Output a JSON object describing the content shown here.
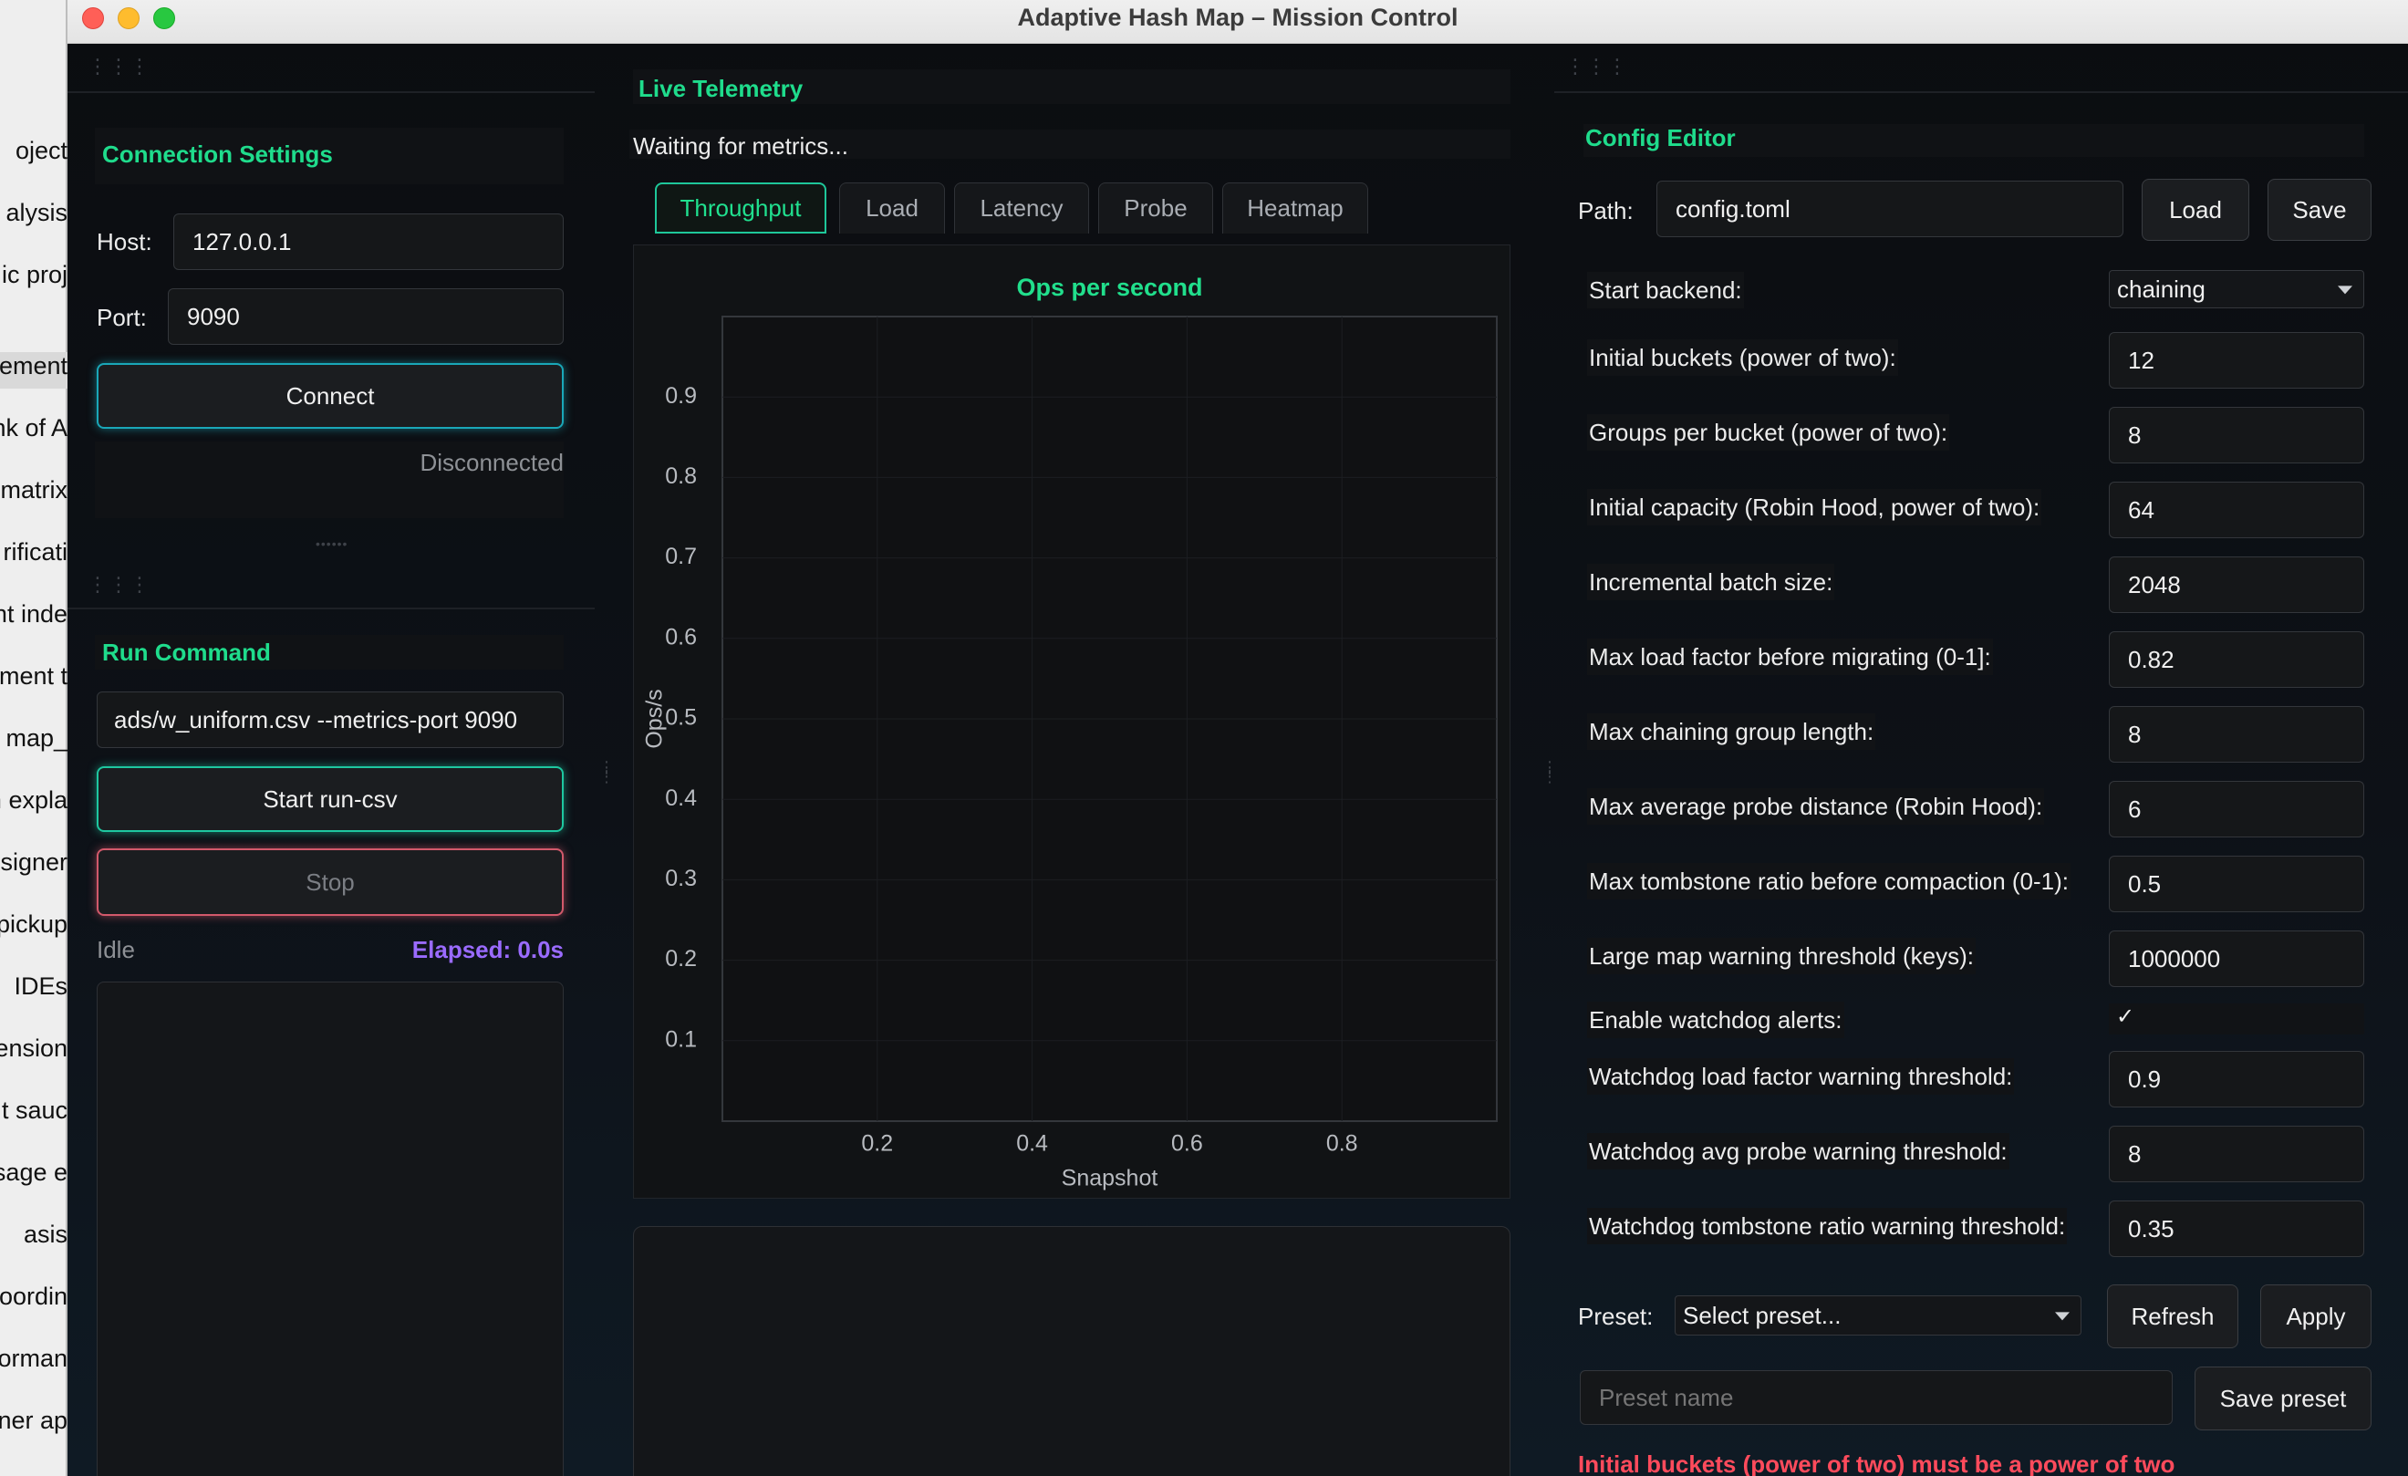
{
  "background_window": {
    "items": [
      "oject",
      "alysis",
      "ic proj",
      "ement",
      "nk of A",
      "matrix",
      "rificati",
      "nt inde",
      "ment t",
      "map_",
      "n expla",
      "esigner",
      "pickup",
      "IDEs",
      "ension",
      "t sauc",
      "sage e",
      "asis",
      "oordin",
      "forman",
      "ner ap"
    ]
  },
  "window": {
    "title": "Adaptive Hash Map – Mission Control"
  },
  "connection": {
    "heading": "Connection Settings",
    "host_label": "Host:",
    "host_value": "127.0.0.1",
    "port_label": "Port:",
    "port_value": "9090",
    "connect_label": "Connect",
    "status": "Disconnected"
  },
  "run": {
    "heading": "Run Command",
    "command_value": "ads/w_uniform.csv --metrics-port 9090",
    "start_label": "Start run-csv",
    "stop_label": "Stop",
    "state": "Idle",
    "elapsed": "Elapsed: 0.0s"
  },
  "telemetry": {
    "heading": "Live Telemetry",
    "status": "Waiting for metrics...",
    "tabs": [
      "Throughput",
      "Load",
      "Latency",
      "Probe",
      "Heatmap"
    ],
    "active_tab": "Throughput"
  },
  "chart_data": {
    "type": "line",
    "title": "Ops per second",
    "xlabel": "Snapshot",
    "ylabel": "Ops/s",
    "xlim": [
      0,
      1
    ],
    "ylim": [
      0,
      1
    ],
    "x_ticks": [
      "0.2",
      "0.4",
      "0.6",
      "0.8"
    ],
    "y_ticks": [
      "0.1",
      "0.2",
      "0.3",
      "0.4",
      "0.5",
      "0.6",
      "0.7",
      "0.8",
      "0.9"
    ],
    "series": [],
    "grid": true
  },
  "config": {
    "heading": "Config Editor",
    "path_label": "Path:",
    "path_value": "config.toml",
    "load_label": "Load",
    "save_label": "Save",
    "start_backend_label": "Start backend:",
    "start_backend_value": "chaining",
    "fields": [
      {
        "label": "Initial buckets (power of two):",
        "value": "12"
      },
      {
        "label": "Groups per bucket (power of two):",
        "value": "8"
      },
      {
        "label": "Initial capacity (Robin Hood, power of two):",
        "value": "64"
      },
      {
        "label": "Incremental batch size:",
        "value": "2048"
      },
      {
        "label": "Max load factor before migrating (0-1]:",
        "value": "0.82"
      },
      {
        "label": "Max chaining group length:",
        "value": "8"
      },
      {
        "label": "Max average probe distance (Robin Hood):",
        "value": "6"
      },
      {
        "label": "Max tombstone ratio before compaction (0-1):",
        "value": "0.5"
      },
      {
        "label": "Large map warning threshold (keys):",
        "value": "1000000"
      }
    ],
    "watchdog_label": "Enable watchdog alerts:",
    "watchdog_check": "✓",
    "watchdog_fields": [
      {
        "label": "Watchdog load factor warning threshold:",
        "value": "0.9"
      },
      {
        "label": "Watchdog avg probe warning threshold:",
        "value": "8"
      },
      {
        "label": "Watchdog tombstone ratio warning threshold:",
        "value": "0.35"
      }
    ],
    "preset_label": "Preset:",
    "preset_select": "Select preset...",
    "refresh_label": "Refresh",
    "apply_label": "Apply",
    "preset_name_placeholder": "Preset name",
    "save_preset_label": "Save preset",
    "error": "Initial buckets (power of two) must be a power of two"
  }
}
